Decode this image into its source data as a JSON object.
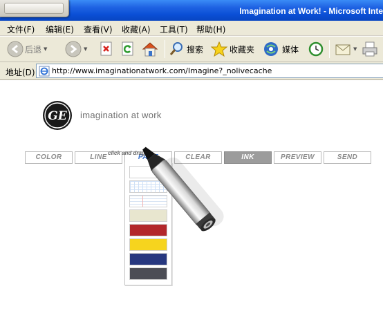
{
  "window": {
    "title": "Imagination at Work! - Microsoft Inte"
  },
  "menu": {
    "items": [
      "文件(F)",
      "编辑(E)",
      "查看(V)",
      "收藏(A)",
      "工具(T)",
      "帮助(H)"
    ]
  },
  "toolbar": {
    "back_label": "后退",
    "search_label": "搜索",
    "favorites_label": "收藏夹",
    "media_label": "媒体"
  },
  "address": {
    "label": "地址(D)",
    "url": "http://www.imaginationatwork.com/Imagine?_nolivecache"
  },
  "page": {
    "brand_text": "imagination at work",
    "logo_text": "GE",
    "hint": "click and drag",
    "tools": {
      "color": "COLOR",
      "line": "LINE",
      "page": "PAGE",
      "clear": "CLEAR",
      "ink": "INK",
      "preview": "PREVIEW",
      "send": "SEND"
    },
    "active_tool": "PAGE",
    "palette_swatches": [
      {
        "kind": "blank",
        "color": "#ffffff"
      },
      {
        "kind": "grid",
        "color": "#ffffff"
      },
      {
        "kind": "ruled",
        "color": "#ffffff"
      },
      {
        "kind": "solid",
        "color": "#e8e6cf"
      },
      {
        "kind": "solid",
        "color": "#b3272b"
      },
      {
        "kind": "solid",
        "color": "#f6d41e"
      },
      {
        "kind": "solid",
        "color": "#273880"
      },
      {
        "kind": "solid",
        "color": "#4c4d55"
      }
    ]
  },
  "colors": {
    "titlebar": "#0a4fd6",
    "chrome": "#ece9d8",
    "active_tab_text": "#3a70c8",
    "ink_tab_bg": "#9c9c9c"
  }
}
